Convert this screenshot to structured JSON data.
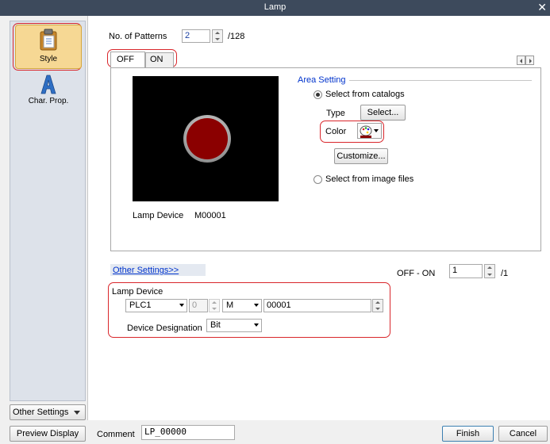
{
  "window": {
    "title": "Lamp",
    "close_glyph": "✕"
  },
  "sidebar": {
    "items": [
      {
        "label": "Style",
        "icon": "clipboard-icon",
        "selected": true
      },
      {
        "label": "Char. Prop.",
        "icon": "letter-a-icon",
        "selected": false
      }
    ],
    "other_settings_label": "Other Settings"
  },
  "patterns": {
    "label": "No. of Patterns",
    "value": "2",
    "max_text": "/128"
  },
  "tabs": [
    {
      "label": "OFF",
      "active": true
    },
    {
      "label": "ON",
      "active": false
    }
  ],
  "preview": {
    "device_label": "Lamp Device",
    "device_value": "M00001",
    "lamp_color": "#8b0000"
  },
  "area_setting": {
    "heading": "Area Setting",
    "select_from_catalogs": "Select from catalogs",
    "type_label": "Type",
    "select_button": "Select...",
    "color_label": "Color",
    "customize_button": "Customize...",
    "select_from_image": "Select from image files"
  },
  "other_settings_link": "Other Settings>>",
  "off_on": {
    "label": "OFF - ON",
    "value": "1",
    "max_text": "/1"
  },
  "lamp_device": {
    "title": "Lamp Device",
    "plc": "PLC1",
    "station": "0",
    "device_type": "M",
    "address": "00001",
    "designation_label": "Device Designation",
    "designation_value": "Bit"
  },
  "footer": {
    "preview_button": "Preview Display",
    "comment_label": "Comment",
    "comment_value": "LP_00000",
    "finish_button": "Finish",
    "cancel_button": "Cancel"
  },
  "colors": {
    "highlight": "#d9262b",
    "link": "#0033cc",
    "titlebar": "#3d4a5c"
  }
}
